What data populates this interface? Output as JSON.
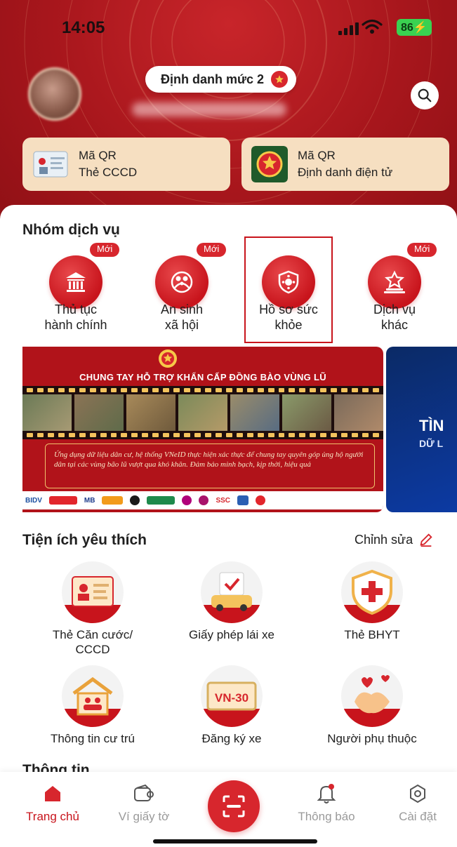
{
  "status_bar": {
    "time": "14:05",
    "battery": "86"
  },
  "header": {
    "level_pill": "Định danh mức 2",
    "qr_cards": [
      {
        "line1": "Mã QR",
        "line2": "Thẻ CCCD"
      },
      {
        "line1": "Mã QR",
        "line2": "Định danh điện tử"
      }
    ]
  },
  "services": {
    "title": "Nhóm dịch vụ",
    "new_badge": "Mới",
    "items": [
      {
        "label1": "Thủ tục",
        "label2": "hành chính",
        "icon": "bank-icon",
        "is_new": true
      },
      {
        "label1": "An sinh",
        "label2": "xã hội",
        "icon": "family-icon",
        "is_new": true
      },
      {
        "label1": "Hồ sơ sức",
        "label2": "khỏe",
        "icon": "health-shield-icon",
        "is_new": false,
        "highlighted": true
      },
      {
        "label1": "Dịch vụ",
        "label2": "khác",
        "icon": "star-podium-icon",
        "is_new": true
      }
    ]
  },
  "banner": {
    "title": "CHUNG TAY HỖ TRỢ KHẨN CẤP ĐỒNG BÀO VÙNG LŨ",
    "note": "Ứng dụng dữ liệu dân cư, hệ thống VNeID thực hiện xác thực để chung tay quyên góp ủng hộ người dân tại các vùng bão lũ vượt qua khó khăn. Đảm bảo minh bạch, kịp thời, hiệu quả",
    "sponsors": [
      "BIDV",
      "MB",
      "SSC"
    ],
    "next_banner_line1": "TÌN",
    "next_banner_line2": "DỮ L"
  },
  "favorites": {
    "title": "Tiện ích yêu thích",
    "edit_label": "Chỉnh sửa",
    "items": [
      {
        "label1": "Thẻ Căn cước/",
        "label2": "CCCD",
        "icon": "id-card-icon"
      },
      {
        "label1": "Giấy phép lái xe",
        "label2": "",
        "icon": "driver-license-icon"
      },
      {
        "label1": "Thẻ BHYT",
        "label2": "",
        "icon": "health-insurance-icon"
      },
      {
        "label1": "Thông tin cư trú",
        "label2": "",
        "icon": "residence-icon"
      },
      {
        "label1": "Đăng ký xe",
        "label2": "",
        "icon": "vehicle-plate-icon",
        "plate": "VN-30"
      },
      {
        "label1": "Người phụ thuộc",
        "label2": "",
        "icon": "dependents-icon"
      }
    ]
  },
  "info_section_title": "Thông tin",
  "bottom_nav": [
    {
      "label": "Trang chủ",
      "active": true
    },
    {
      "label": "Ví giấy tờ",
      "active": false
    },
    {
      "label": "Thông báo",
      "active": false
    },
    {
      "label": "Cài đặt",
      "active": false
    }
  ],
  "colors": {
    "brand_red": "#c8141c",
    "cream": "#f6dfc1",
    "new_badge": "#d7262d"
  }
}
